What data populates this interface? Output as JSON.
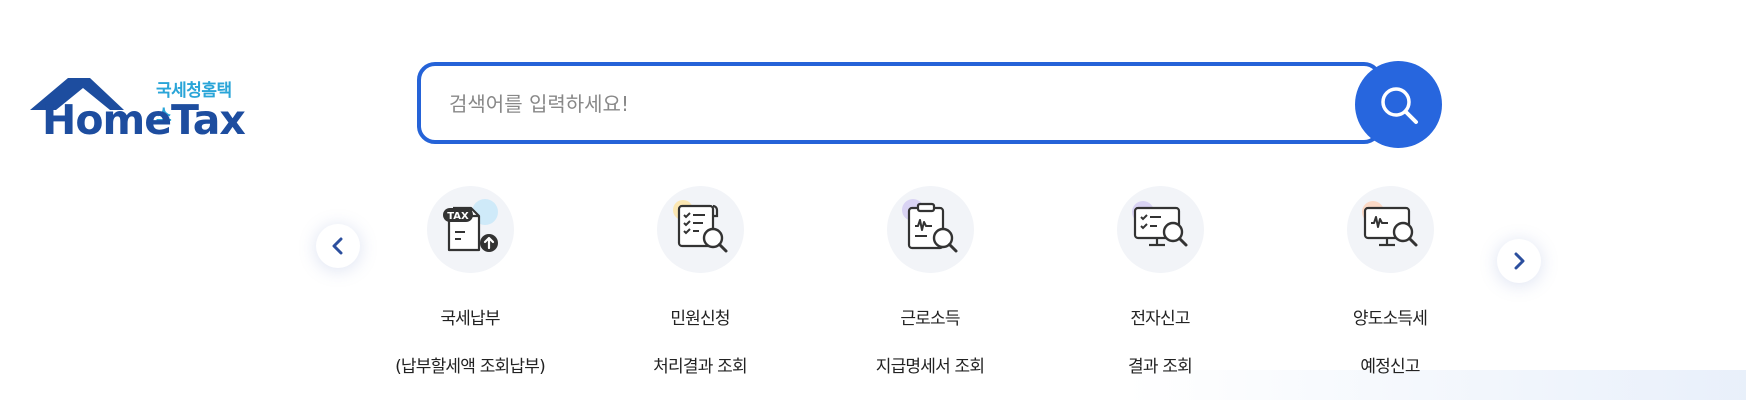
{
  "logo": {
    "korean_text": "국세청홈택스",
    "english_text": "HomeTax"
  },
  "search": {
    "placeholder": "검색어를 입력하세요!",
    "value": ""
  },
  "quick_menu": {
    "items": [
      {
        "line1": "국세납부",
        "line2": "(납부할세액 조회납부)",
        "icon": "tax-payment-icon",
        "badge_text": "TAX"
      },
      {
        "line1": "민원신청",
        "line2": "처리결과 조회",
        "icon": "document-search-icon"
      },
      {
        "line1": "근로소득",
        "line2": "지급명세서 조회",
        "icon": "clipboard-search-icon"
      },
      {
        "line1": "전자신고",
        "line2": "결과 조회",
        "icon": "monitor-checklist-icon"
      },
      {
        "line1": "양도소득세",
        "line2": "예정신고",
        "icon": "monitor-won-icon"
      }
    ]
  },
  "colors": {
    "primary": "#2766de",
    "logo_blue": "#1d4d9f",
    "logo_cyan": "#2aa5d8"
  }
}
